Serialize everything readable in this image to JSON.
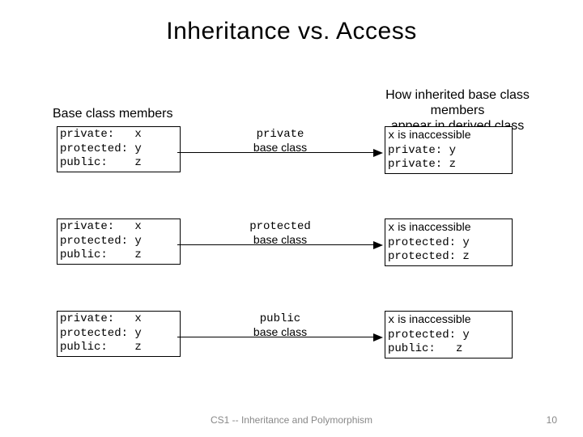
{
  "title": "Inheritance vs. Access",
  "leftHeader": "Base class members",
  "rightHeader1": "How inherited base class members",
  "rightHeader2": "appear in derived class",
  "rows": [
    {
      "left": "private:   x\nprotected: y\npublic:    z",
      "arrowType": "private",
      "arrowBase": "base class",
      "right_l1_a": "x",
      "right_l1_b": " is inaccessible",
      "right_l2": "private: y",
      "right_l3": "private: z"
    },
    {
      "left": "private:   x\nprotected: y\npublic:    z",
      "arrowType": "protected",
      "arrowBase": "base class",
      "right_l1_a": "x",
      "right_l1_b": " is inaccessible",
      "right_l2": "protected: y",
      "right_l3": "protected: z"
    },
    {
      "left": "private:   x\nprotected: y\npublic:    z",
      "arrowType": "public",
      "arrowBase": "base class",
      "right_l1_a": "x",
      "right_l1_b": " is inaccessible",
      "right_l2": "protected: y",
      "right_l3": "public:   z"
    }
  ],
  "footerText": "CS1 -- Inheritance and Polymorphism",
  "pageNum": "10"
}
